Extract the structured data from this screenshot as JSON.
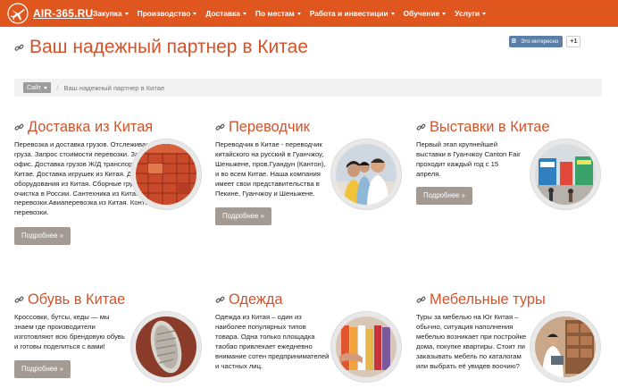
{
  "brand": {
    "name": "AIR-365.RU"
  },
  "nav": {
    "items": [
      {
        "label": "Закупка"
      },
      {
        "label": "Производство"
      },
      {
        "label": "Доставка"
      },
      {
        "label": "По местам"
      },
      {
        "label": "Работа и инвестиции"
      },
      {
        "label": "Обучение"
      },
      {
        "label": "Услуги"
      }
    ]
  },
  "page": {
    "title": "Ваш надежный партнер в Китае"
  },
  "social": {
    "vk_logo": "В",
    "vk_label": "Это интересно",
    "plus_label": "+1"
  },
  "breadcrumb": {
    "site_label": "Сайт",
    "separator": "/",
    "current": "Ваш надежный партнер в Китае"
  },
  "cards": [
    {
      "title": "Доставка из Китая",
      "text": "Перевозка и доставка грузов. Отслеживание вашего груза. Запрос стоимости перевозки. Заказ звонка вам в офис. Доставка грузов Ж/Д транспортом. Склад в Китае. Доставка игрушек из Китая. Доставка оборудования из Китая. Сборные грузы. Таможенная очистка в России. Сантехника из Китая. Морские перевозки.Авиаперевозка из Китая. Контейнерные перевозки.",
      "button": "Подробнее »",
      "image": "containers"
    },
    {
      "title": "Переводчик",
      "text": "Переводчик в Китае - переводчик китайского на русский в Гуанчжоу, Шеньжене, пров.Гуандун (Кантон), и во всем Китае. Наша компания имеет свои представительства в Пекине, Гуанчжоу и Шеньжене.",
      "button": "Подробнее »",
      "image": "people"
    },
    {
      "title": "Выставки в Китае",
      "text": "Первый этап крупнейшей выставки в Гуанчжоу Canton Fair проходит каждый год с 15 апреля.",
      "button": "Подробнее »",
      "image": "exhibition"
    },
    {
      "title": "Обувь в Китае",
      "text": "Кроссовки, бутсы, кеды — мы знаем где производители изготовляют всю брендовую обувь и готовы поделиться с вами!",
      "button": "Подробнее »",
      "image": "shoe"
    },
    {
      "title": "Одежда",
      "text": "Одежда из Китая – один из наиболее популярных типов товара. Одна только площадка таобао привлекает ежедневно внимание сотен предпринимателей и частных лиц.",
      "button": "Подробнее »",
      "image": "clothes"
    },
    {
      "title": "Мебельные туры",
      "text": "Туры за мебелью на Юг Китая – обычно, ситуация наполнения мебелью возникает при постройке дома, покупке квартиры. Стоит ли заказывать мебель по каталогам или выбрать её увидев воочию?",
      "button": "Подробнее »",
      "image": "furniture"
    }
  ],
  "colors": {
    "accent": "#e0561f",
    "title": "#d2532a",
    "button": "#a39a93",
    "vk": "#5b7fa6"
  }
}
